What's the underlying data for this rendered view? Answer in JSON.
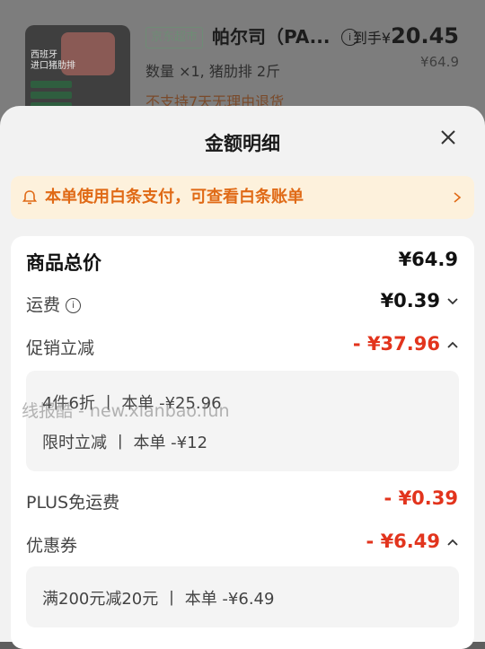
{
  "product": {
    "store_tag": "京东超市",
    "title": "帕尔司（PA...",
    "price_label": "到手¥",
    "price_value": "20.45",
    "original_price": "¥64.9",
    "quantity_text": "数量 ×1, 猪肋排 2斤",
    "return_note": "不支持7天无理由退货",
    "thumb_text": "西班牙\n进口猪肋排"
  },
  "sheet": {
    "title": "金额明细",
    "notice": "本单使用白条支付，可查看白条账单"
  },
  "details": {
    "total": {
      "label": "商品总价",
      "value": "¥64.9"
    },
    "shipping": {
      "label": "运费",
      "value": "¥0.39"
    },
    "promo": {
      "label": "促销立减",
      "value": "- ¥37.96",
      "items": [
        "4件6折 丨 本单 -¥25.96",
        "限时立减 丨 本单 -¥12"
      ]
    },
    "plus": {
      "label": "PLUS免运费",
      "value": "- ¥0.39"
    },
    "coupon": {
      "label": "优惠券",
      "value": "- ¥6.49",
      "items": [
        "满200元减20元 丨 本单 -¥6.49"
      ]
    }
  },
  "watermark": "线报酷 - new.xianbao.fun",
  "colors": {
    "accent_red": "#e2341d",
    "notice_orange": "#e06a16",
    "notice_bg": "#fdf1dc"
  }
}
